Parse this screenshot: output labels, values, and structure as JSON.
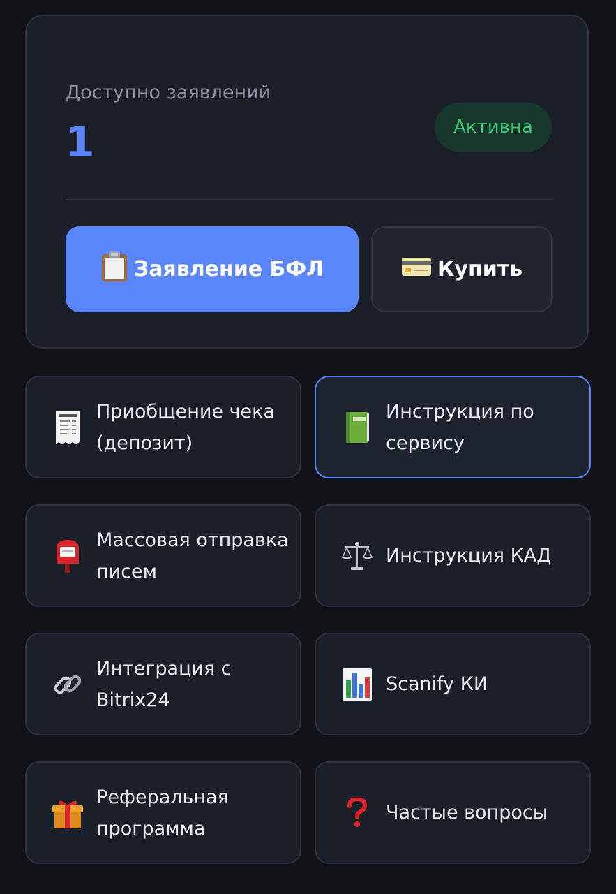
{
  "balance": {
    "label": "Доступно заявлений",
    "count": "1",
    "status": "Активна",
    "accent_color": "#5b85f6",
    "status_color": "#38c777"
  },
  "actions": {
    "primary": {
      "icon": "clipboard-icon",
      "label": "Заявление БФЛ"
    },
    "secondary": {
      "icon": "credit-card-icon",
      "label": "Купить"
    }
  },
  "menu": {
    "items": [
      {
        "icon": "receipt-icon",
        "label": "Приобщение чека (депозит)"
      },
      {
        "icon": "green-book-icon",
        "label": "Инструкция по сервису",
        "selected": true
      },
      {
        "icon": "postbox-icon",
        "label": "Массовая отправка писем"
      },
      {
        "icon": "scales-icon",
        "label": "Инструкция КАД"
      },
      {
        "icon": "link-icon",
        "label": "Интеграция с Bitrix24"
      },
      {
        "icon": "bar-chart-icon",
        "label": "Scanify КИ"
      },
      {
        "icon": "gift-icon",
        "label": "Реферальная программа"
      },
      {
        "icon": "question-mark-icon",
        "label": "Частые вопросы"
      }
    ]
  }
}
